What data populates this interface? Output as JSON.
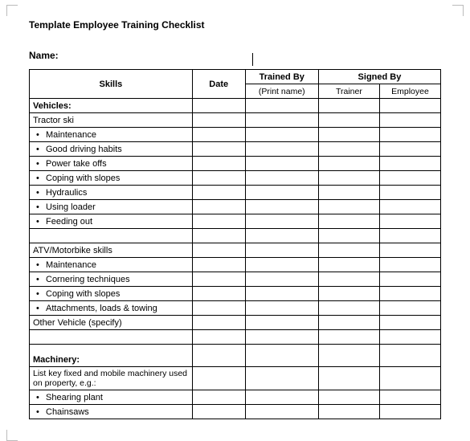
{
  "title": "Template Employee Training Checklist",
  "name_label": "Name:",
  "headers": {
    "skills": "Skills",
    "date": "Date",
    "trained_by": "Trained By",
    "trained_by_sub": "(Print name)",
    "signed_by": "Signed By",
    "trainer": "Trainer",
    "employee": "Employee"
  },
  "rows": [
    {
      "type": "section",
      "label": "Vehicles:"
    },
    {
      "type": "plain",
      "label": "Tractor ski"
    },
    {
      "type": "bullet",
      "label": "Maintenance"
    },
    {
      "type": "bullet",
      "label": "Good driving habits"
    },
    {
      "type": "bullet",
      "label": "Power take offs"
    },
    {
      "type": "bullet",
      "label": "Coping with slopes"
    },
    {
      "type": "bullet",
      "label": "Hydraulics"
    },
    {
      "type": "bullet",
      "label": "Using loader"
    },
    {
      "type": "bullet",
      "label": "Feeding out"
    },
    {
      "type": "blank",
      "label": ""
    },
    {
      "type": "plain",
      "label": "ATV/Motorbike skills"
    },
    {
      "type": "bullet",
      "label": "Maintenance"
    },
    {
      "type": "bullet",
      "label": "Cornering techniques"
    },
    {
      "type": "bullet",
      "label": "Coping with slopes"
    },
    {
      "type": "bullet",
      "label": "Attachments, loads & towing"
    },
    {
      "type": "plain",
      "label": "Other Vehicle (specify)"
    },
    {
      "type": "blank",
      "label": ""
    },
    {
      "type": "section_tall",
      "label": "Machinery:"
    },
    {
      "type": "desc",
      "label": "List key fixed and mobile machinery used on property, e.g.:"
    },
    {
      "type": "bullet",
      "label": "Shearing plant"
    },
    {
      "type": "bullet",
      "label": "Chainsaws"
    }
  ]
}
